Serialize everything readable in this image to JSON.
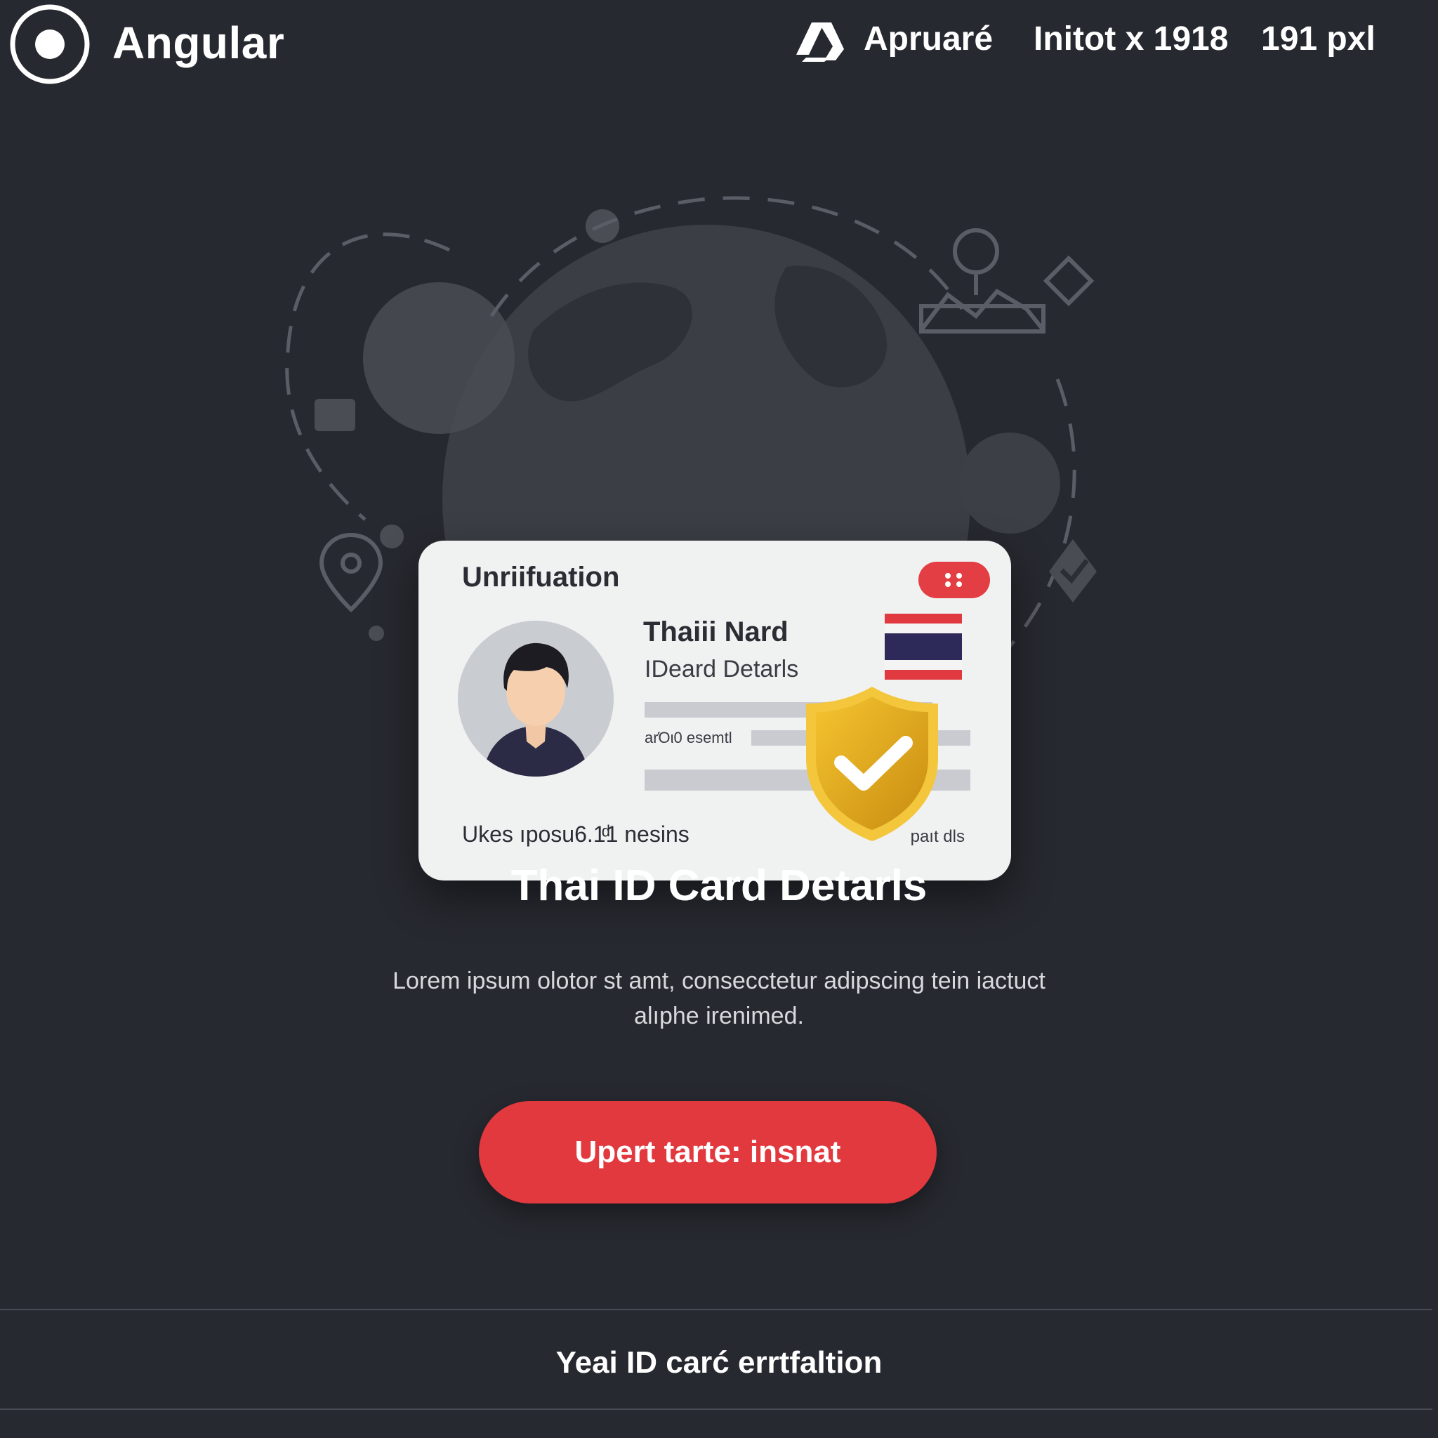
{
  "header": {
    "brand": "Angular",
    "nav": {
      "item1": "Apruaré",
      "item2": "Initot x 1918",
      "item3": "191 pxl"
    }
  },
  "card": {
    "title": "Unriifuation",
    "holder_name": "Thaiii Nard",
    "holder_sub": "IDeard Detarls",
    "field_label": "arΌι0 esemtl",
    "footer_left": "Ukes ıposu6.1ͩ1 nesins",
    "footer_right": "paıt dls"
  },
  "main": {
    "title": "Thai ID Card Detarls",
    "description": "Lorem ipsum olotor st amt, consecctetur adipscing tein iactuct alıphe irenimed.",
    "cta_label": "Upert tarte: insnat"
  },
  "footer": {
    "text": "Yeai ID carć errtfaltion"
  },
  "icons": {
    "logo": "radio-circle-icon",
    "nav_glyph": "a-letter-logo-icon",
    "badge": "verified-shield-icon",
    "flag": "thailand-flag-icon"
  },
  "colors": {
    "background": "#272930",
    "accent": "#e2393f",
    "card": "#f0f1f1",
    "shield": "#e8b41f"
  }
}
